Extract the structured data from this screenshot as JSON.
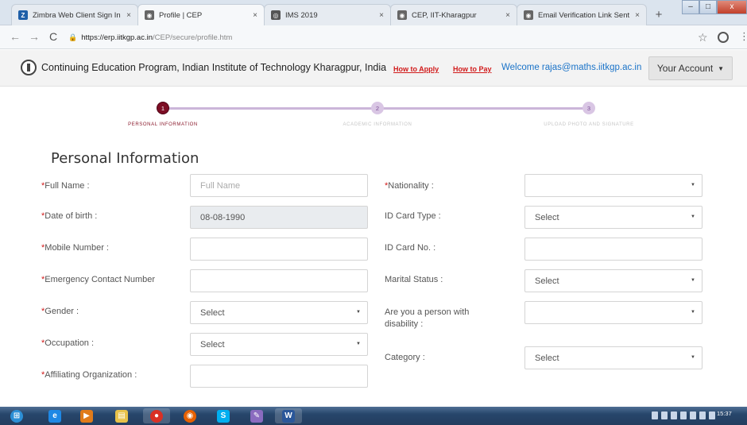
{
  "browser": {
    "tabs": [
      {
        "title": "Zimbra Web Client Sign In",
        "icon": "zimbra-icon",
        "color": "#1f5fa8",
        "active": false
      },
      {
        "title": "Profile | CEP",
        "icon": "iit-logo-icon",
        "color": "#555555",
        "active": true
      },
      {
        "title": "IMS 2019",
        "icon": "globe-icon",
        "color": "#555555",
        "active": false
      },
      {
        "title": "CEP, IIT-Kharagpur",
        "icon": "iit-logo-icon",
        "color": "#555555",
        "active": false
      },
      {
        "title": "Email Verification Link Sent",
        "icon": "iit-logo-icon",
        "color": "#555555",
        "active": false
      }
    ],
    "tab_close_glyph": "×",
    "new_tab_glyph": "+",
    "url_secure_glyph": "🔒",
    "url_host": "https://erp.iitkgp.ac.in",
    "url_path": "/CEP/secure/profile.htm"
  },
  "header": {
    "brand": "Continuing Education Program, Indian Institute of Technology Kharagpur, India",
    "links": [
      "How to Apply",
      "How to Pay"
    ],
    "welcome": "Welcome rajas@maths.iitkgp.ac.in",
    "account_button": "Your Account"
  },
  "steps": [
    {
      "number": "1",
      "label": "PERSONAL INFORMATION",
      "active": true
    },
    {
      "number": "2",
      "label": "ACADEMIC INFORMATION",
      "active": false
    },
    {
      "number": "3",
      "label": "UPLOAD PHOTO AND SIGNATURE",
      "active": false
    }
  ],
  "form": {
    "title": "Personal Information",
    "required_mark": "*",
    "left": [
      {
        "label": "Full Name :",
        "required": true,
        "type": "text",
        "value": "",
        "placeholder": "Full Name"
      },
      {
        "label": "Date of birth :",
        "required": true,
        "type": "text",
        "value": "08-08-1990",
        "disabled": true
      },
      {
        "label": "Mobile Number :",
        "required": true,
        "type": "text",
        "value": ""
      },
      {
        "label": "Emergency Contact Number",
        "required": true,
        "type": "text",
        "value": ""
      },
      {
        "label": "Gender :",
        "required": true,
        "type": "select",
        "value": "Select"
      },
      {
        "label": "Occupation :",
        "required": true,
        "type": "select",
        "value": "Select"
      },
      {
        "label": "Affiliating Organization :",
        "required": true,
        "type": "text",
        "value": ""
      }
    ],
    "right": [
      {
        "label": "Nationality :",
        "required": true,
        "type": "select",
        "value": ""
      },
      {
        "label": "ID Card Type :",
        "required": false,
        "type": "select",
        "value": "Select"
      },
      {
        "label": "ID Card No. :",
        "required": false,
        "type": "text",
        "value": ""
      },
      {
        "label": "Marital Status :",
        "required": false,
        "type": "select",
        "value": "Select"
      },
      {
        "label": "Are you a person with disability :",
        "required": false,
        "type": "select",
        "value": ""
      },
      {
        "label": "Category :",
        "required": false,
        "type": "select",
        "value": "Select"
      }
    ]
  },
  "taskbar": {
    "apps": [
      {
        "name": "windows-start-icon",
        "glyph": "⊞",
        "color": "#2c8fd6"
      },
      {
        "name": "internet-explorer-icon",
        "glyph": "e",
        "color": "#1e88e5"
      },
      {
        "name": "windows-media-player-icon",
        "glyph": "▶",
        "color": "#e07b1a"
      },
      {
        "name": "file-explorer-icon",
        "glyph": "▤",
        "color": "#e8c24a"
      },
      {
        "name": "chrome-icon",
        "glyph": "●",
        "color": "#d93025"
      },
      {
        "name": "firefox-icon",
        "glyph": "◉",
        "color": "#e66000"
      },
      {
        "name": "skype-icon",
        "glyph": "S",
        "color": "#00aff0"
      },
      {
        "name": "paint-icon",
        "glyph": "✎",
        "color": "#8a6bbf"
      },
      {
        "name": "word-icon",
        "glyph": "W",
        "color": "#2b579a"
      }
    ],
    "clock": "15:37"
  }
}
